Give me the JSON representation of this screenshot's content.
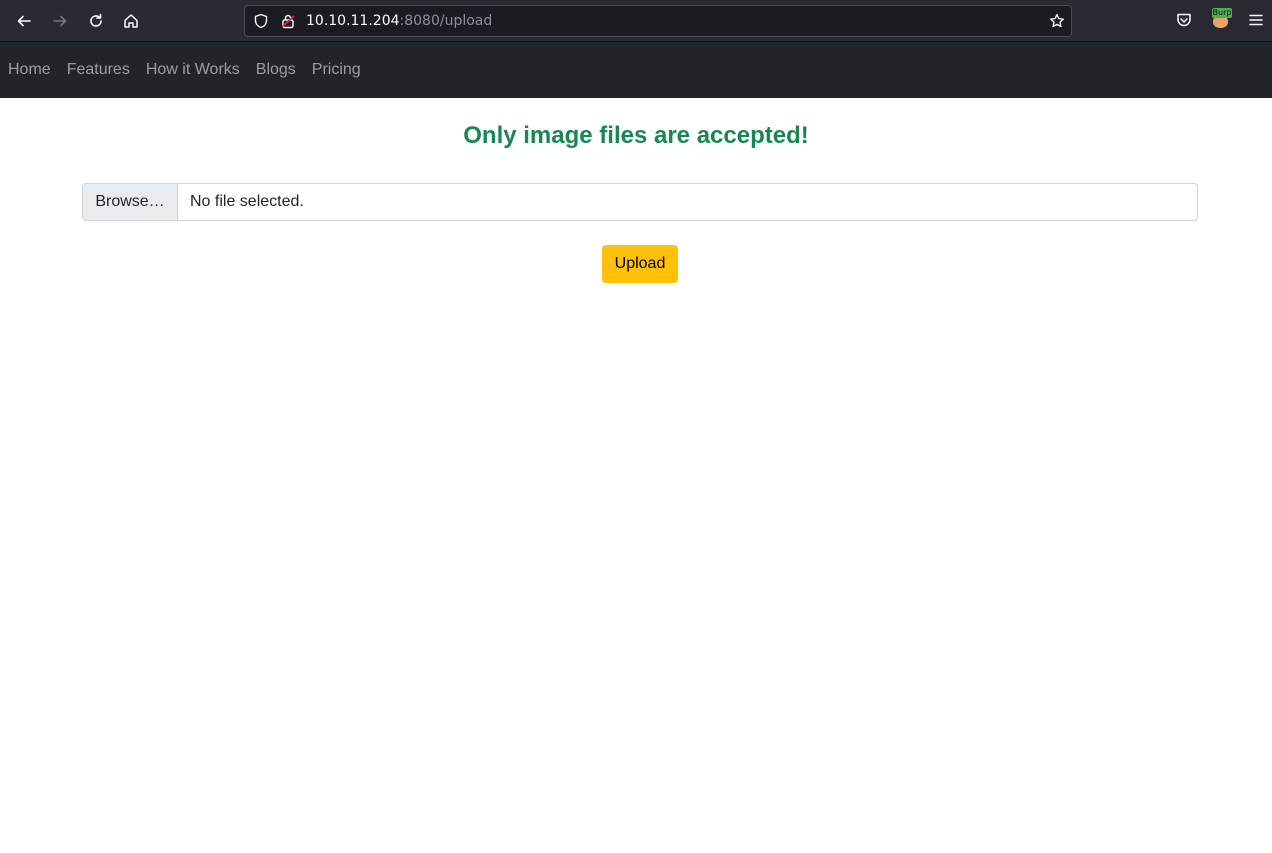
{
  "browser": {
    "url_host": "10.10.11.204",
    "url_rest": ":8080/upload",
    "burp_label": "Burp",
    "icons": [
      "back-icon",
      "forward-icon",
      "reload-icon",
      "home-icon",
      "shield-icon",
      "lock-icon",
      "star-icon",
      "pocket-icon",
      "burp-extension-icon",
      "menu-icon"
    ]
  },
  "nav": {
    "items": [
      {
        "label": "Home"
      },
      {
        "label": "Features"
      },
      {
        "label": "How it Works"
      },
      {
        "label": "Blogs"
      },
      {
        "label": "Pricing"
      }
    ]
  },
  "main": {
    "message": "Only image files are accepted!",
    "browse_label": "Browse…",
    "file_status": "No file selected.",
    "upload_label": "Upload"
  },
  "colors": {
    "message": "#198754",
    "upload_button": "#ffc107",
    "navbar": "#212529",
    "chrome": "#2b2a33"
  }
}
